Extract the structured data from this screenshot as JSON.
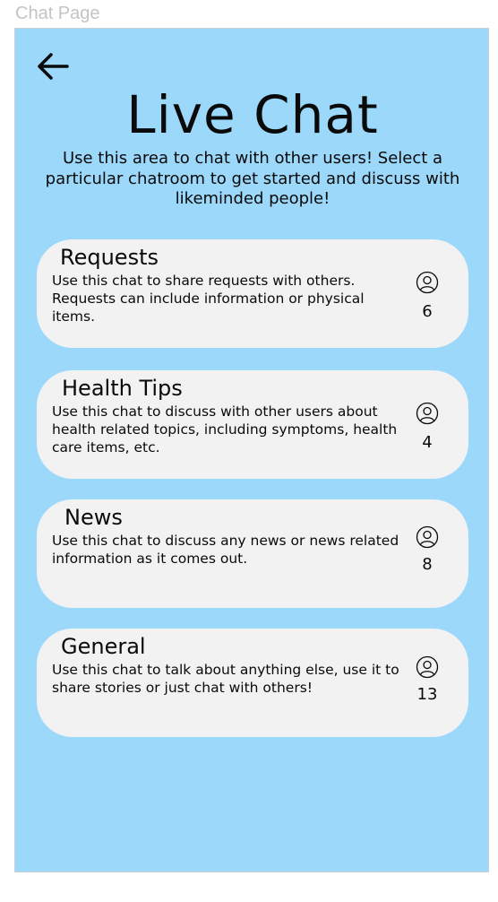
{
  "frame": {
    "label": "Chat Page"
  },
  "header": {
    "back_icon": "arrow-left-icon",
    "title": "Live Chat",
    "subtitle": "Use this area to chat with other users! Select a particular chatroom to get started and discuss with likeminded people!"
  },
  "colors": {
    "background": "#9bd8fa",
    "card": "#f2f2f2",
    "text": "#0a0a0a"
  },
  "rooms": [
    {
      "name": "Requests",
      "description": "Use this chat to share requests with others. Requests can include information or physical items.",
      "icon": "user-icon",
      "count": "6"
    },
    {
      "name": "Health Tips",
      "description": "Use this chat to discuss with other users about health related topics, including symptoms, health care items, etc.",
      "icon": "user-icon",
      "count": "4"
    },
    {
      "name": "News",
      "description": "Use this chat to discuss any news or news related information as it comes out.",
      "icon": "user-icon",
      "count": "8"
    },
    {
      "name": "General",
      "description": "Use this chat to talk about anything else, use it to share stories or just chat with others!",
      "icon": "user-icon",
      "count": "13"
    }
  ]
}
